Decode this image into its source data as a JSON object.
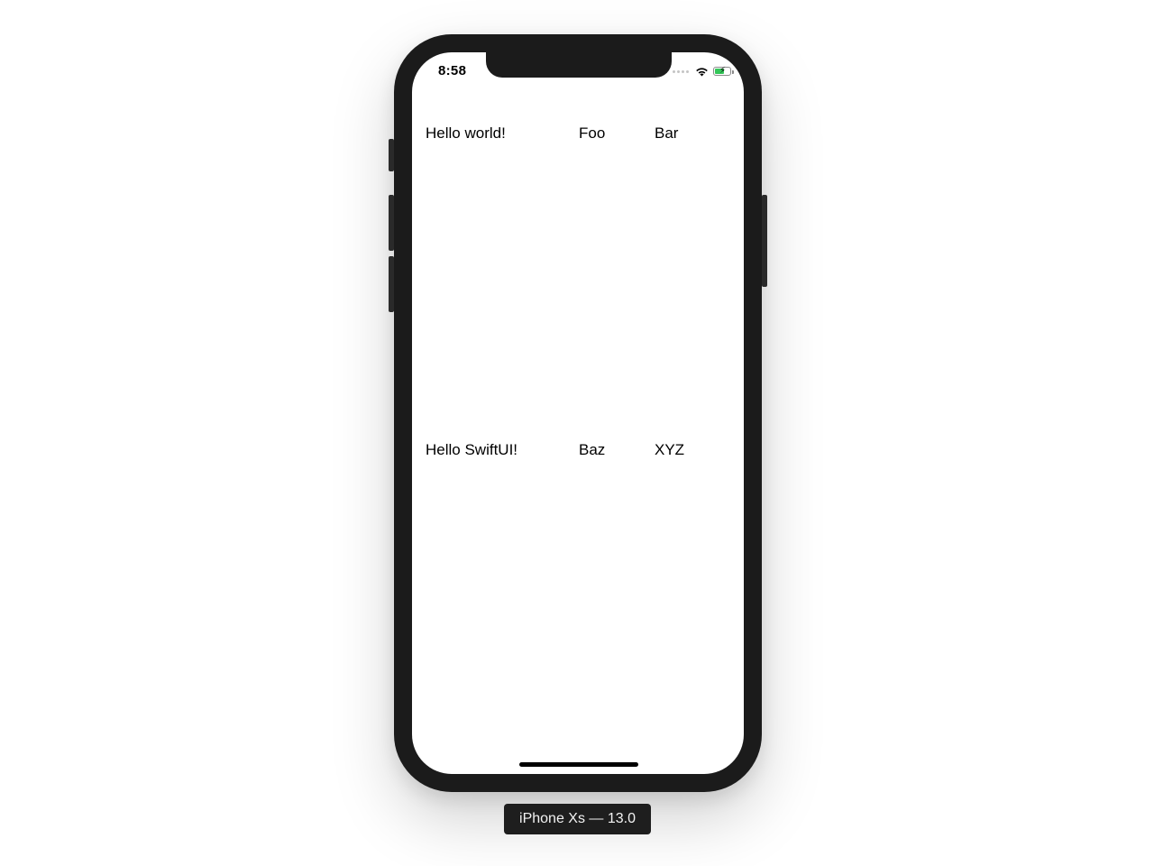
{
  "status_bar": {
    "time": "8:58",
    "icons": [
      "signal-dots-icon",
      "wifi-icon",
      "battery-charging-icon"
    ],
    "battery_color": "#34c759"
  },
  "grid": {
    "rows": [
      [
        "Hello world!",
        "Foo",
        "Bar"
      ],
      [
        "Hello SwiftUI!",
        "Baz",
        "XYZ"
      ]
    ]
  },
  "device_label": "iPhone Xs — 13.0",
  "colors": {
    "bezel": "#1b1b1b",
    "screen": "#ffffff",
    "label_bg": "#1e1e1e"
  }
}
